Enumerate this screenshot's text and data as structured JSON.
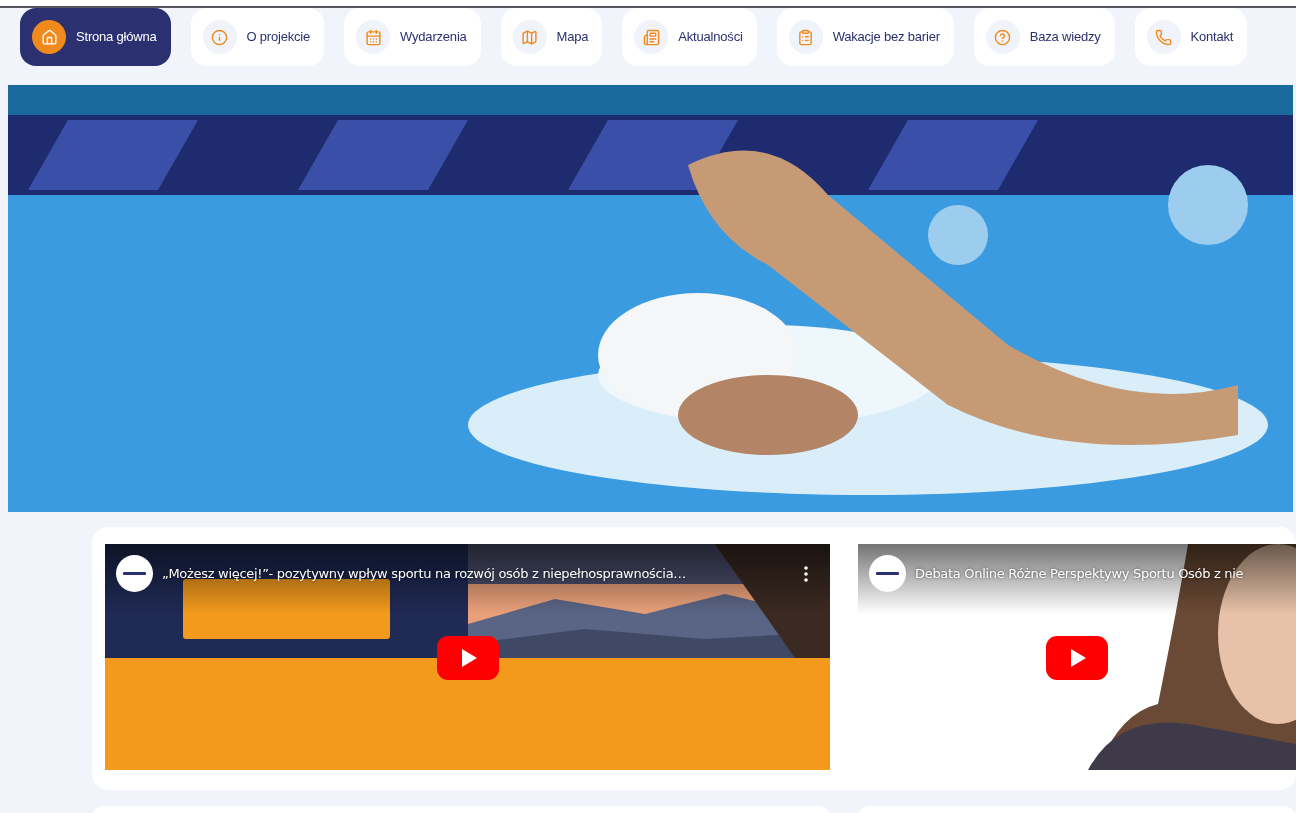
{
  "nav": [
    {
      "label": "Strona główna",
      "selected": true
    },
    {
      "label": "O projekcie",
      "selected": false
    },
    {
      "label": "Wydarzenia",
      "selected": false
    },
    {
      "label": "Mapa",
      "selected": false
    },
    {
      "label": "Aktualności",
      "selected": false
    },
    {
      "label": "Wakacje bez barier",
      "selected": false
    },
    {
      "label": "Baza wiedzy",
      "selected": false
    },
    {
      "label": "Kontakt",
      "selected": false
    }
  ],
  "videos": [
    {
      "title": "„Możesz więcej!”- pozytywny wpływ sportu na rozwój osób z niepełnosprawnościa…",
      "menu": true
    },
    {
      "title": "Debata Online Różne Perspektywy Sportu Osób z nie",
      "menu": false
    }
  ]
}
